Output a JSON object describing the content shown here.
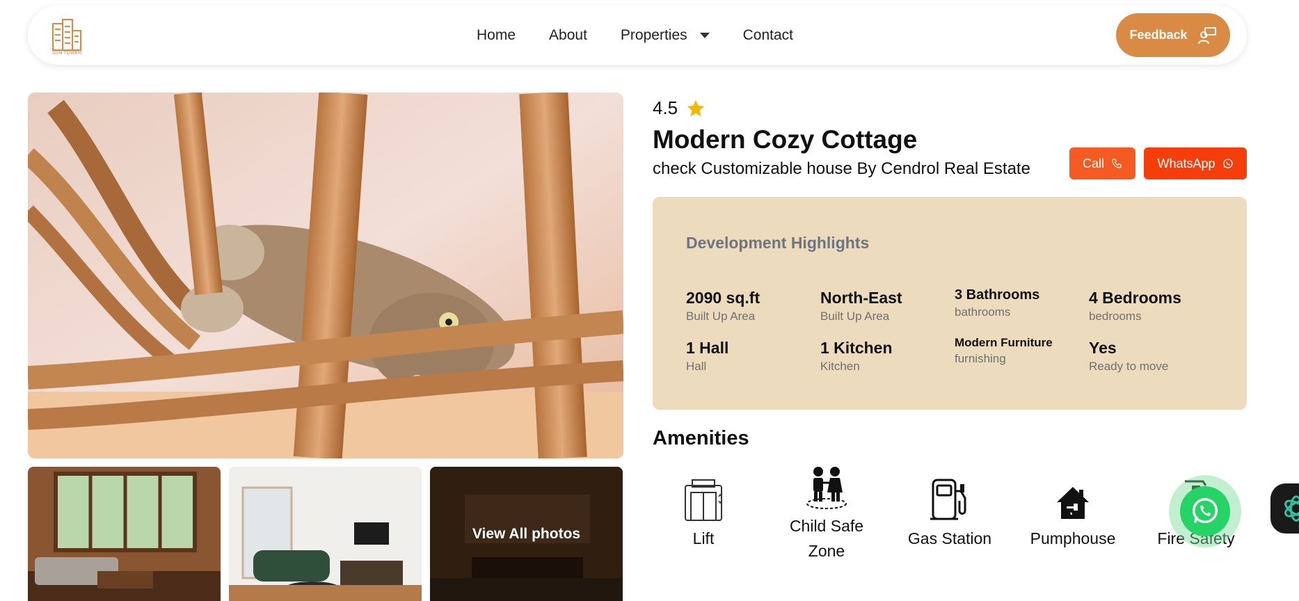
{
  "navbar": {
    "logo_text": "SUN TOWER",
    "links": [
      {
        "label": "Home"
      },
      {
        "label": "About"
      },
      {
        "label": "Properties"
      },
      {
        "label": "Contact"
      }
    ],
    "feedback_label": "Feedback"
  },
  "gallery": {
    "view_all_label": "View All photos"
  },
  "property": {
    "rating": "4.5",
    "title": "Modern Cozy Cottage",
    "subtitle": "check Customizable house By Cendrol Real Estate",
    "call_label": "Call",
    "whatsapp_label": "WhatsApp"
  },
  "highlights": {
    "title": "Development Highlights",
    "items": [
      {
        "value": "2090 sq.ft",
        "label": "Built Up Area"
      },
      {
        "value": "North-East",
        "label": "Built Up Area"
      },
      {
        "value": "3 Bathrooms",
        "label": "bathrooms"
      },
      {
        "value": "4 Bedrooms",
        "label": "bedrooms"
      },
      {
        "value": "1 Hall",
        "label": "Hall"
      },
      {
        "value": "1 Kitchen",
        "label": "Kitchen"
      },
      {
        "value": "Modern Furniture",
        "label": "furnishing"
      },
      {
        "value": "Yes",
        "label": "Ready to move"
      }
    ]
  },
  "amenities": {
    "title": "Amenities",
    "items": [
      {
        "label": "Lift",
        "icon": "elevator-icon"
      },
      {
        "label": "Child Safe Zone",
        "icon": "children-icon"
      },
      {
        "label": "Gas Station",
        "icon": "fuel-pump-icon"
      },
      {
        "label": "Pumphouse",
        "icon": "pumphouse-icon"
      },
      {
        "label": "Fire Safety",
        "icon": "fire-extinguisher-icon"
      }
    ]
  },
  "colors": {
    "accent": "#d98a45",
    "call": "#f45a22",
    "whatsapp_btn": "#f53e0c",
    "highlights_bg": "#ecdbbd",
    "star": "#f2b705",
    "whatsapp_fab": "#25d366"
  }
}
